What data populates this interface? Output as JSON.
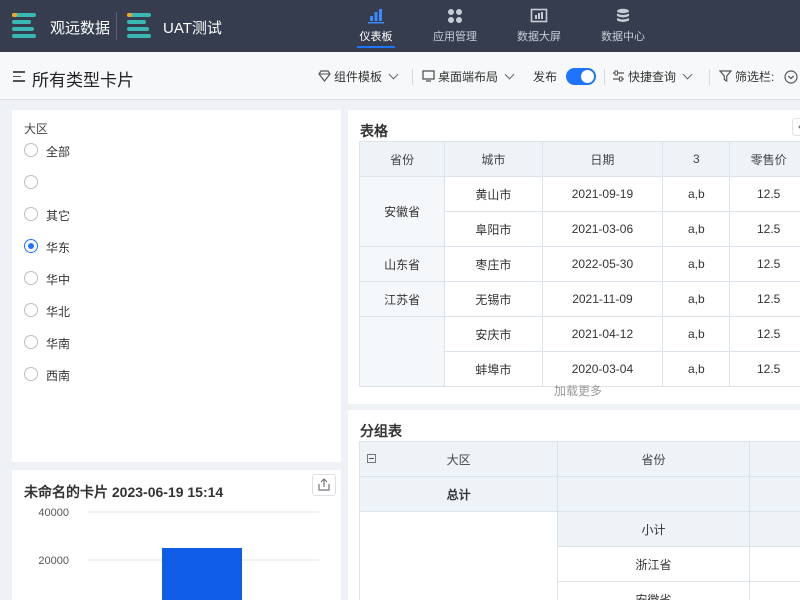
{
  "header": {
    "brand": "观远数据",
    "project": "UAT测试",
    "nav": [
      {
        "label": "仪表板",
        "icon": "bar-chart-icon",
        "active": true
      },
      {
        "label": "应用管理",
        "icon": "apps-icon",
        "active": false
      },
      {
        "label": "数据大屏",
        "icon": "screen-icon",
        "active": false
      },
      {
        "label": "数据中心",
        "icon": "database-icon",
        "active": false
      }
    ]
  },
  "subheader": {
    "title": "所有类型卡片",
    "component_template": "组件模板",
    "layout": "桌面端布局",
    "publish": "发布",
    "publish_on": true,
    "quick_query": "快捷查询",
    "filter_bar": "筛选栏:"
  },
  "radio_card": {
    "title": "大区",
    "options": [
      "全部",
      "",
      "其它",
      "华东",
      "华中",
      "华北",
      "华南",
      "西南"
    ],
    "selected": "华东"
  },
  "chart_card": {
    "title": "未命名的卡片 2023-06-19 15:14",
    "chart_data": {
      "type": "bar",
      "yticks": [
        "40000",
        "20000"
      ],
      "values": [
        25000
      ],
      "ylim": [
        0,
        45000
      ]
    }
  },
  "table_card": {
    "title": "表格",
    "columns": [
      "省份",
      "城市",
      "日期",
      "3",
      "零售价"
    ],
    "rows": [
      {
        "province": "安徽省",
        "city": "黄山市",
        "date": "2021-09-19",
        "c3": "a,b",
        "price": "12.5"
      },
      {
        "province": "",
        "city": "阜阳市",
        "date": "2021-03-06",
        "c3": "a,b",
        "price": "12.5"
      },
      {
        "province": "山东省",
        "city": "枣庄市",
        "date": "2022-05-30",
        "c3": "a,b",
        "price": "12.5"
      },
      {
        "province": "江苏省",
        "city": "无锡市",
        "date": "2021-11-09",
        "c3": "a,b",
        "price": "12.5"
      },
      {
        "province": "",
        "city": "安庆市",
        "date": "2021-04-12",
        "c3": "a,b",
        "price": "12.5"
      },
      {
        "province": "",
        "city": "蚌埠市",
        "date": "2020-03-04",
        "c3": "a,b",
        "price": "12.5"
      }
    ],
    "load_more": "加载更多"
  },
  "group_card": {
    "title": "分组表",
    "columns": [
      "大区",
      "省份",
      ""
    ],
    "total_label": "总计",
    "rows": [
      "小计",
      "浙江省",
      "安徽省"
    ]
  }
}
